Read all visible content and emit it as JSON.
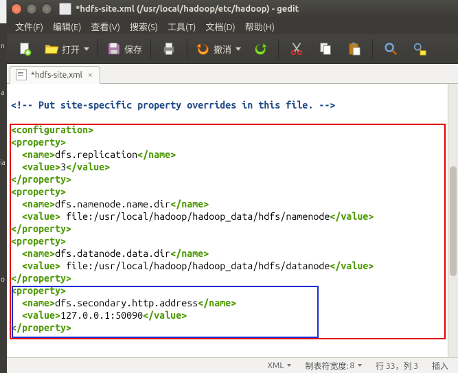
{
  "window": {
    "title": "*hdfs-site.xml (/usr/local/hadoop/etc/hadoop) - gedit"
  },
  "menubar": {
    "file": "文件(F)",
    "edit": "编辑(E)",
    "view": "查看(V)",
    "search": "搜索(S)",
    "tools": "工具(T)",
    "documents": "文档(D)",
    "help": "帮助(H)"
  },
  "toolbar": {
    "open_label": "打开",
    "save_label": "保存",
    "undo_label": "撤消",
    "icons": {
      "new": "new-doc-icon",
      "open": "folder-open-icon",
      "save": "save-icon",
      "print": "print-icon",
      "undo": "undo-icon",
      "redo": "redo-icon",
      "cut": "scissors-icon",
      "copy": "copy-icon",
      "paste": "paste-icon",
      "find": "search-icon",
      "replace": "replace-icon"
    }
  },
  "tabs": [
    {
      "label": "*hdfs-site.xml"
    }
  ],
  "editor": {
    "comment": "<!-- Put site-specific property overrides in this file. -->",
    "lines": [
      {
        "type": "tag",
        "text": "<configuration>"
      },
      {
        "type": "tag",
        "text": "<property>"
      },
      {
        "open": "  <name>",
        "body": "dfs.replication",
        "close": "</name>"
      },
      {
        "open": "  <value>",
        "body": "3",
        "close": "</value>"
      },
      {
        "type": "tag",
        "text": "</property>"
      },
      {
        "type": "tag",
        "text": "<property>"
      },
      {
        "open": "  <name>",
        "body": "dfs.namenode.name.dir",
        "close": "</name>"
      },
      {
        "open": "  <value>",
        "body": " file:/usr/local/hadoop/hadoop_data/hdfs/namenode",
        "close": "</value>"
      },
      {
        "type": "tag",
        "text": "</property>"
      },
      {
        "type": "tag",
        "text": "<property>"
      },
      {
        "open": "  <name>",
        "body": "dfs.datanode.data.dir",
        "close": "</name>"
      },
      {
        "open": "  <value>",
        "body": " file:/usr/local/hadoop/hadoop_data/hdfs/datanode",
        "close": "</value>"
      },
      {
        "type": "tag",
        "text": "</property>"
      },
      {
        "type": "tag",
        "text": "<property>"
      },
      {
        "open": "  <name>",
        "body": "dfs.secondary.http.address",
        "close": "</name>"
      },
      {
        "open": "  <value>",
        "body": "127.0.0.1:50090",
        "close": "</value>"
      },
      {
        "type": "tag",
        "text": "</property>"
      }
    ]
  },
  "statusbar": {
    "language": "XML",
    "tabwidth_label": "制表符宽度:",
    "tabwidth_value": "8",
    "position": "行 33，列 3",
    "insert_mode": "插入"
  },
  "colors": {
    "tag": "#4e9a06",
    "comment": "#204A87"
  }
}
